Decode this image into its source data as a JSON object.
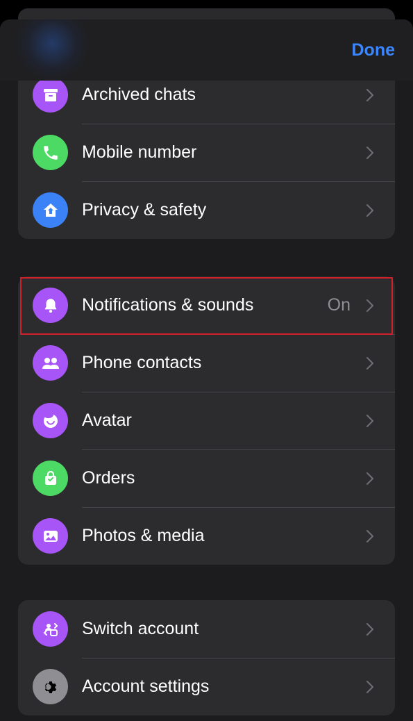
{
  "header": {
    "done_label": "Done"
  },
  "groups": [
    {
      "items": [
        {
          "label": "Archived chats",
          "icon": "archive-icon",
          "color": "#a855f7"
        },
        {
          "label": "Mobile number",
          "icon": "phone-icon",
          "color": "#4cd964"
        },
        {
          "label": "Privacy & safety",
          "icon": "shield-home-icon",
          "color": "#3b82f6"
        }
      ]
    },
    {
      "items": [
        {
          "label": "Notifications & sounds",
          "value": "On",
          "icon": "bell-icon",
          "color": "#a855f7"
        },
        {
          "label": "Phone contacts",
          "icon": "people-icon",
          "color": "#a855f7"
        },
        {
          "label": "Avatar",
          "icon": "avatar-icon",
          "color": "#a855f7"
        },
        {
          "label": "Orders",
          "icon": "shopping-bag-icon",
          "color": "#4cd964"
        },
        {
          "label": "Photos & media",
          "icon": "photo-icon",
          "color": "#a855f7"
        }
      ]
    },
    {
      "items": [
        {
          "label": "Switch account",
          "icon": "switch-account-icon",
          "color": "#a855f7"
        },
        {
          "label": "Account settings",
          "icon": "gear-icon",
          "color": "#8e8e93"
        }
      ]
    }
  ]
}
